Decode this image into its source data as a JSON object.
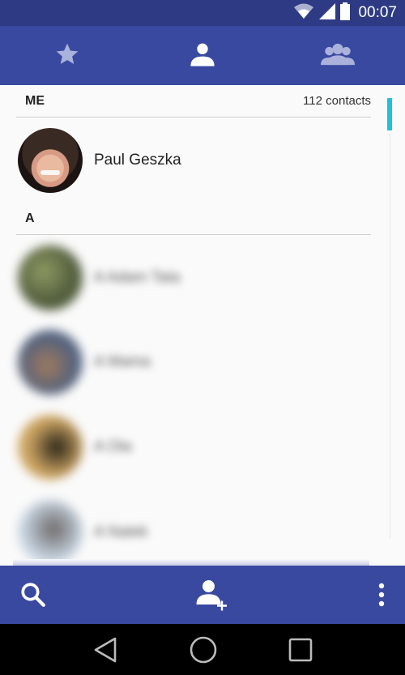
{
  "status_bar": {
    "time": "00:07",
    "icons": [
      "wifi-icon",
      "signal-icon",
      "battery-icon"
    ]
  },
  "tabs": [
    {
      "name": "favorites",
      "icon": "star-icon",
      "active": false
    },
    {
      "name": "contacts",
      "icon": "person-icon",
      "active": true
    },
    {
      "name": "groups",
      "icon": "groups-icon",
      "active": false
    }
  ],
  "sections": {
    "me": {
      "title": "ME",
      "count": "112 contacts"
    },
    "a": {
      "title": "A"
    }
  },
  "me_contact": {
    "name": "Paul Geszka"
  },
  "contacts": [
    {
      "name": "A Adam Tata"
    },
    {
      "name": "A Mama"
    },
    {
      "name": "A Ola"
    },
    {
      "name": "A Natek"
    }
  ],
  "action_bar": {
    "icons": [
      "search-icon",
      "add-person-icon",
      "more-vert-icon"
    ]
  },
  "navigation": {
    "icons": [
      "back-icon",
      "home-icon",
      "recents-icon"
    ]
  },
  "colors": {
    "primary": "#3949a0",
    "primary_dark": "#2e3b84",
    "accent": "#1ec2d9"
  }
}
